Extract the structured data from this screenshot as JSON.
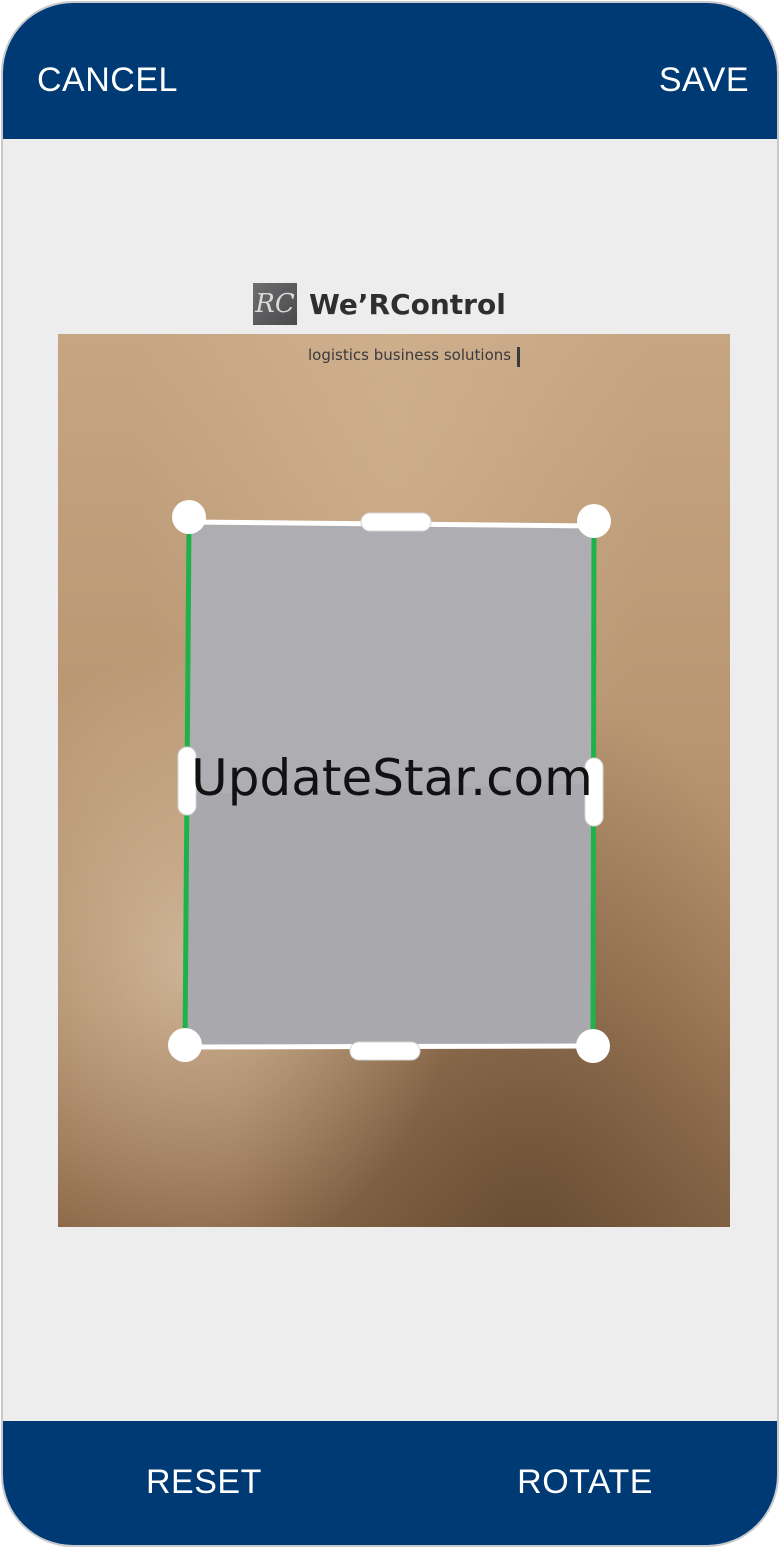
{
  "header": {
    "cancel_label": "CANCEL",
    "save_label": "SAVE"
  },
  "footer": {
    "reset_label": "RESET",
    "rotate_label": "ROTATE"
  },
  "document": {
    "logo_text": "RC",
    "brand_name": "We’RControl",
    "tagline": "logistics business solutions"
  },
  "watermark": "UpdateStar.com",
  "colors": {
    "bar": "#003a75",
    "crop_edge_active": "#1fb24a",
    "crop_edge": "#ffffff",
    "handle": "#ffffff",
    "background": "#ededee"
  },
  "icons": [
    "corner-handle",
    "edge-handle"
  ]
}
